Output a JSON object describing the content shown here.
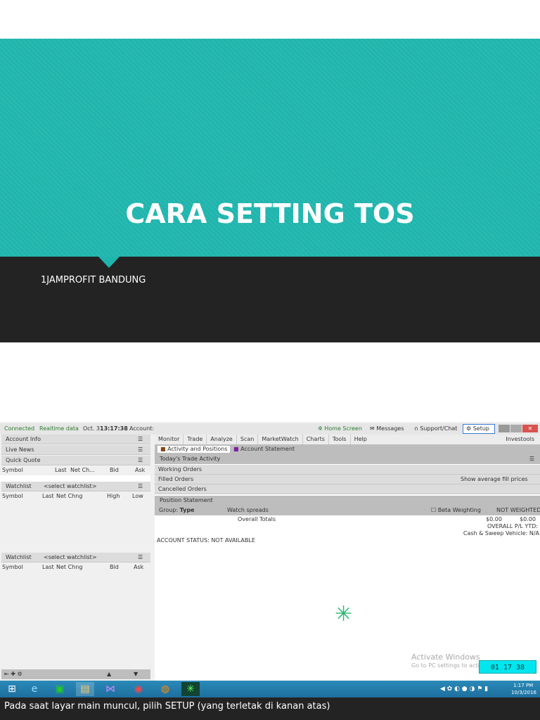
{
  "slide": {
    "title": "CARA SETTING TOS",
    "subtitle": "1JAMPROFIT BANDUNG",
    "caption": "Pada saat layar main muncul, pilih SETUP (yang terletak di kanan atas)"
  },
  "status": {
    "connected": "Connected",
    "realtime": "Realtime data",
    "date": "Oct. 3",
    "time": "13:17:38",
    "account": "Account:"
  },
  "topbuttons": {
    "home": "Home Screen",
    "messages": "Messages",
    "support": "Support/Chat",
    "setup": "Setup"
  },
  "left": {
    "account_info": "Account Info",
    "live_news": "Live News",
    "quick_quote": "Quick Quote",
    "qq_cols": [
      "Symbol",
      "Last",
      "Net Ch...",
      "Bid",
      "Ask"
    ],
    "watchlist": "Watchlist",
    "select_watchlist": "<select watchlist>",
    "wl1_cols": [
      "Symbol",
      "Last",
      "Net Chng",
      "High",
      "Low"
    ],
    "wl2_cols": [
      "Symbol",
      "Last",
      "Net Chng",
      "Bid",
      "Ask"
    ]
  },
  "menu": [
    "Monitor",
    "Trade",
    "Analyze",
    "Scan",
    "MarketWatch",
    "Charts",
    "Tools",
    "Help"
  ],
  "investools": "Investools",
  "subtabs": {
    "activity": "Activity and Positions",
    "statement": "Account Statement"
  },
  "monitor": {
    "today": "Today's Trade Activity",
    "working": "Working Orders",
    "filled": "Filled Orders",
    "show_avg": "Show average fill prices",
    "cancelled": "Cancelled Orders",
    "position": "Position Statement",
    "group_label": "Group:",
    "group_value": "Type",
    "watch_spreads": "Watch spreads",
    "beta": "Beta Weighting",
    "not_weighted": "NOT WEIGHTED",
    "overall_totals": "Overall Totals",
    "val1": "$0.00",
    "val2": "$0.00",
    "pl_ytd": "OVERALL P/L YTD:",
    "cash_sweep": "Cash & Sweep Vehicle: N/A",
    "account_status": "ACCOUNT STATUS: NOT AVAILABLE"
  },
  "watermark": {
    "line1": "Activate Windows",
    "line2": "Go to PC settings to acti"
  },
  "clock": "01 17 38",
  "tray": {
    "time": "1:17 PM",
    "date": "10/3/2016"
  },
  "colors": {
    "teal": "#1fb5ad",
    "dark": "#232323",
    "accent_green": "#2e7d32"
  }
}
